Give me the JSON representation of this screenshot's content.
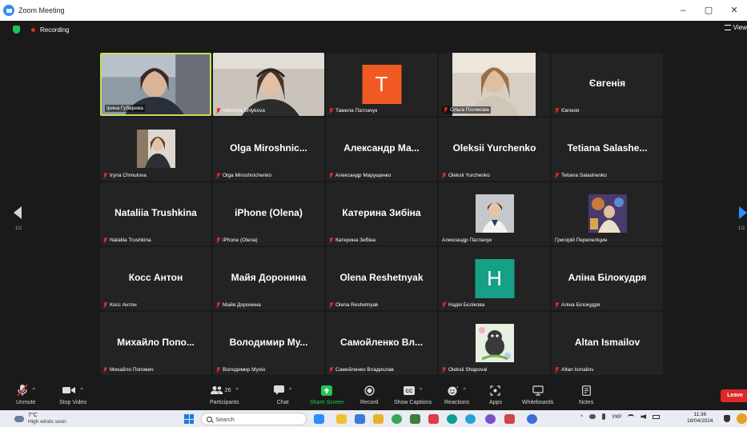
{
  "window": {
    "title": "Zoom Meeting",
    "controls": [
      "–",
      "▢",
      "✕"
    ]
  },
  "meeting": {
    "recording_label": "Recording",
    "view_label": "View"
  },
  "participants": [
    {
      "display_name": "",
      "label": "Ірина Губарева",
      "kind": "video",
      "active": true
    },
    {
      "display_name": "",
      "label": "Viktoriya Shlykova",
      "kind": "video"
    },
    {
      "display_name": "T",
      "label": "Тамила Патлачук",
      "kind": "letter",
      "color": "#f05a22"
    },
    {
      "display_name": "",
      "label": "Ольга Полякова",
      "kind": "video"
    },
    {
      "display_name": "Євгенія",
      "label": "Євгенія",
      "kind": "name"
    },
    {
      "display_name": "",
      "label": "Iryna Chmutova",
      "kind": "avatar"
    },
    {
      "display_name": "Olga Miroshnic...",
      "label": "Olga Miroshnichenko",
      "kind": "name"
    },
    {
      "display_name": "Александр Ма...",
      "label": "Александр Марущенко",
      "kind": "name"
    },
    {
      "display_name": "Oleksii Yurchenko",
      "label": "Oleksii Yurchenko",
      "kind": "name"
    },
    {
      "display_name": "Tetiana Salashe...",
      "label": "Tetiana Salashenko",
      "kind": "name"
    },
    {
      "display_name": "Nataliia Trushkina",
      "label": "Nataliia Trushkina",
      "kind": "name"
    },
    {
      "display_name": "iPhone (Olena)",
      "label": "iPhone (Olena)",
      "kind": "name"
    },
    {
      "display_name": "Катерина Зибіна",
      "label": "Катерина Зибіна",
      "kind": "name"
    },
    {
      "display_name": "",
      "label": "Александр Патлачук",
      "kind": "avatar",
      "unmuted": true
    },
    {
      "display_name": "",
      "label": "Григорій Перепеліцин",
      "kind": "avatar",
      "unmuted": true
    },
    {
      "display_name": "Косс Антон",
      "label": "Косс Антон",
      "kind": "name"
    },
    {
      "display_name": "Майя Доронина",
      "label": "Майя Доронина",
      "kind": "name"
    },
    {
      "display_name": "Olena Reshetnyak",
      "label": "Olena Reshetnyak",
      "kind": "name"
    },
    {
      "display_name": "H",
      "label": "Надія Бєлікова",
      "kind": "letter",
      "color": "#16a085"
    },
    {
      "display_name": "Аліна Білокудря",
      "label": "Аліна Білокудря",
      "kind": "name"
    },
    {
      "display_name": "Михайло Попо...",
      "label": "Михайло Попович",
      "kind": "name"
    },
    {
      "display_name": "Володимир Му...",
      "label": "Володимир Мухін",
      "kind": "name"
    },
    {
      "display_name": "Самойленко Вл...",
      "label": "Самойленко Владислав",
      "kind": "name"
    },
    {
      "display_name": "",
      "label": "Oleksii Shapoval",
      "kind": "avatar"
    },
    {
      "display_name": "Altan Ismailov",
      "label": "Altan Ismailov",
      "kind": "name"
    }
  ],
  "pager": {
    "left": "1/2",
    "right": "1/2"
  },
  "toolbar": {
    "unmute": "Unmute",
    "stop_video": "Stop Video",
    "participants": "Participants",
    "participants_count": "26",
    "chat": "Chat",
    "share_screen": "Share Screen",
    "record": "Record",
    "captions": "Show Captions",
    "reactions": "Reactions",
    "apps": "Apps",
    "whiteboards": "Whiteboards",
    "notes": "Notes",
    "leave": "Leave"
  },
  "taskbar": {
    "temperature": "7°C",
    "weather_desc": "High winds soon",
    "search_placeholder": "Search",
    "language": "УКР",
    "time": "11:36",
    "date": "18/04/2024"
  },
  "colors": {
    "accent": "#2d8cff",
    "active_speaker": "#c4e05a",
    "leave": "#e02828",
    "share": "#23c552"
  }
}
